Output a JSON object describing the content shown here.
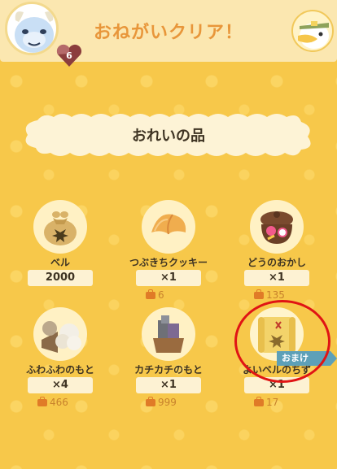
{
  "header": {
    "title": "おねがいクリア！",
    "heart_count": "6"
  },
  "banner": {
    "title": "おれいの品"
  },
  "items": [
    {
      "name": "ベル",
      "quantity": "2000",
      "owned": "",
      "icon": "bell-bag-icon"
    },
    {
      "name": "つぶきちクッキー",
      "quantity": "×1",
      "owned": "6",
      "icon": "fortune-cookie-icon"
    },
    {
      "name": "どうのおかし",
      "quantity": "×1",
      "owned": "135",
      "icon": "candy-pot-icon"
    },
    {
      "name": "ふわふわのもと",
      "quantity": "×4",
      "owned": "466",
      "icon": "wool-icon"
    },
    {
      "name": "カチカチのもと",
      "quantity": "×1",
      "owned": "999",
      "icon": "stone-icon"
    },
    {
      "name": "よいベルのちず",
      "quantity": "×1",
      "owned": "17",
      "icon": "map-icon"
    }
  ],
  "bonus_tag": "おまけ",
  "colors": {
    "background": "#f7c84a",
    "title": "#e8963a",
    "owned_text": "#c8822c",
    "bonus_tag": "#5da0b8",
    "annotation": "#e01414"
  }
}
